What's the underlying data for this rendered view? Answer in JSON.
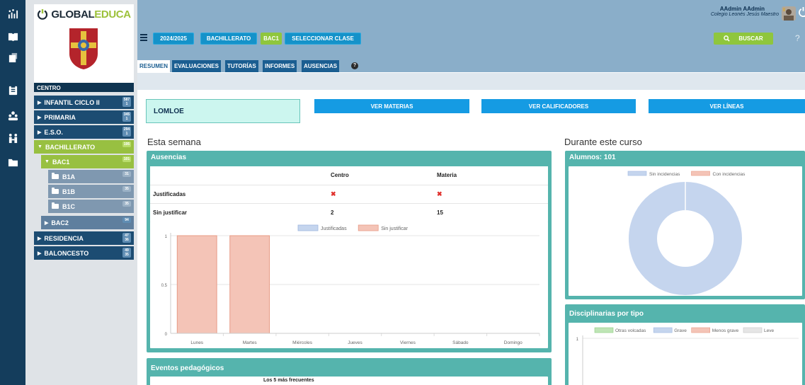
{
  "brand": {
    "name_a": "GLOBAL",
    "name_b": "EDUCA"
  },
  "user": {
    "name": "AAdmin AAdmin",
    "school": "Colegio Leonés Jesús Maestro"
  },
  "icons": [
    "dashboard-icon",
    "book-icon",
    "report-icon",
    "clipboard-icon",
    "users-icon",
    "family-icon",
    "folder-icon"
  ],
  "sidebar": {
    "centro_label": "CENTRO",
    "items": [
      {
        "label": "INFANTIL CICLO II",
        "b1": "587",
        "b2": "1"
      },
      {
        "label": "PRIMARIA",
        "b1": "345",
        "b2": "1"
      },
      {
        "label": "E.S.O.",
        "b1": "294",
        "b2": "1"
      },
      {
        "label": "BACHILLERATO",
        "b1": "195",
        "b2": ""
      },
      {
        "label": "BAC1",
        "b1": "101",
        "b2": ""
      },
      {
        "label": "B1A",
        "b1": "31",
        "b2": ""
      },
      {
        "label": "B1B",
        "b1": "35",
        "b2": ""
      },
      {
        "label": "B1C",
        "b1": "35",
        "b2": ""
      },
      {
        "label": "BAC2",
        "b1": "94",
        "b2": ""
      },
      {
        "label": "RESIDENCIA",
        "b1": "47",
        "b2": "36"
      },
      {
        "label": "BALONCESTO",
        "b1": "49",
        "b2": "35"
      }
    ]
  },
  "menubar": {
    "year": "2024/2025",
    "level": "BACHILLERATO",
    "course": "BAC1",
    "select_class": "SELECCIONAR CLASE",
    "search": "BUSCAR"
  },
  "tabs": [
    "RESUMEN",
    "EVALUACIONES",
    "TUTORÍAS",
    "INFORMES",
    "AUSENCIAS"
  ],
  "main": {
    "lomloe": "LOMLOE",
    "buttons": [
      "VER MATERIAS",
      "VER CALIFICADORES",
      "VER LÍNEAS"
    ],
    "week_heading": "Esta semana",
    "course_heading": "Durante este curso",
    "ausencias": {
      "title": "Ausencias",
      "col_centro": "Centro",
      "col_materia": "Materia",
      "rows": [
        {
          "label": "Justificadas",
          "centro": "✖",
          "materia": "✖"
        },
        {
          "label": "Sin justificar",
          "centro": "2",
          "materia": "15"
        }
      ]
    },
    "alumnos_title": "Alumnos: 101",
    "disciplinarias_title": "Disciplinarias por tipo",
    "eventos_title": "Eventos pedagógicos",
    "eventos_subtitle": "Los 5 más frecuentes"
  },
  "colors": {
    "navy": "#143d5c",
    "teal": "#55b4ad",
    "blue_btn": "#159be3",
    "green": "#8fc63d",
    "bar_red": "#f4c4b7",
    "bar_blue": "#c5d5ee"
  },
  "chart_data": [
    {
      "type": "bar",
      "categories": [
        "Lunes",
        "Martes",
        "Miércoles",
        "Jueves",
        "Viernes",
        "Sábado",
        "Domingo"
      ],
      "series": [
        {
          "name": "Justificadas",
          "values": [
            0,
            0,
            0,
            0,
            0,
            0,
            0
          ]
        },
        {
          "name": "Sin justificar",
          "values": [
            1,
            1,
            0,
            0,
            0,
            0,
            0
          ]
        }
      ],
      "ylim": [
        0,
        1
      ],
      "yticks": [
        "0",
        "0.5",
        "1"
      ],
      "legend": "top"
    },
    {
      "type": "pie",
      "donut": true,
      "labels": [
        "Sin incidencias",
        "Con incidencias"
      ],
      "values": [
        101,
        0
      ],
      "legend": "top"
    },
    {
      "type": "bar",
      "legend_entries": [
        "Otras volcadas",
        "Grave",
        "Menos grave",
        "Leve"
      ],
      "yticks": [
        "1"
      ],
      "legend": "top"
    }
  ]
}
